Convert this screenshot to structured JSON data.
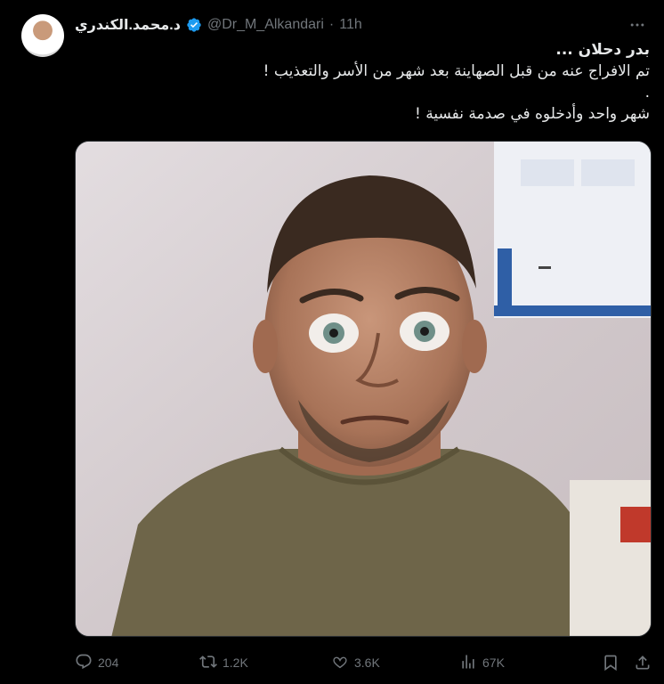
{
  "author": {
    "display_name": "د.محمد.الكندري",
    "handle": "@Dr_M_Alkandari",
    "separator": "·",
    "time": "11h"
  },
  "tweet": {
    "lines": [
      "بدر دحلان ...",
      "تم الافراج عنه من قبل الصهاينة بعد شهر من الأسر والتعذيب !",
      ".",
      "شهر واحد وأدخلوه في صدمة نفسية !"
    ]
  },
  "stats": {
    "replies": "204",
    "reposts": "1.2K",
    "likes": "3.6K",
    "views": "67K"
  },
  "icons": {
    "verified": "verified-badge-icon",
    "more": "more-icon",
    "reply": "reply-icon",
    "repost": "repost-icon",
    "like": "like-icon",
    "views": "views-icon",
    "bookmark": "bookmark-icon",
    "share": "share-icon"
  },
  "colors": {
    "background": "#000000",
    "text": "#e7e9ea",
    "muted": "#71767b",
    "verified": "#1d9bf0"
  }
}
